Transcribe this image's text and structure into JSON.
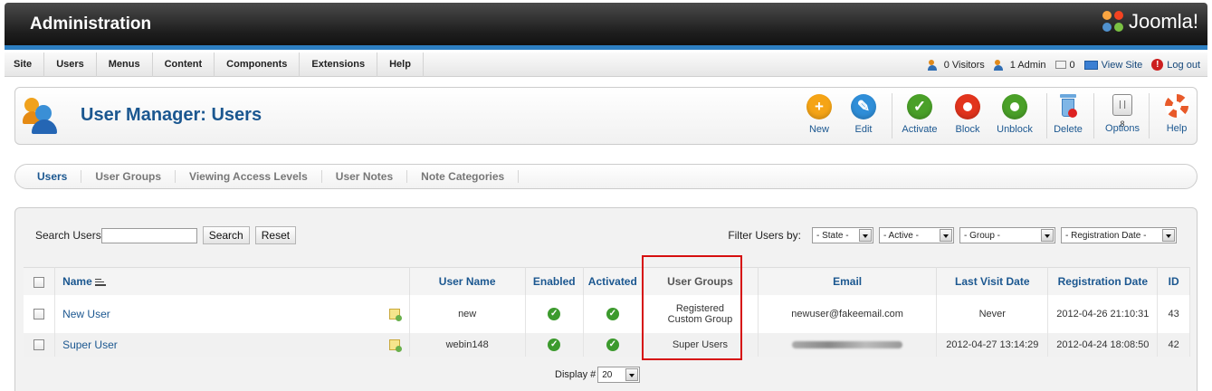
{
  "header": {
    "title": "Administration",
    "logo_text": "Joomla!"
  },
  "menu": [
    "Site",
    "Users",
    "Menus",
    "Content",
    "Components",
    "Extensions",
    "Help"
  ],
  "status": {
    "visitors": "0 Visitors",
    "admins": "1 Admin",
    "messages": "0",
    "view_site": "View Site",
    "logout": "Log out"
  },
  "page": {
    "title": "User Manager: Users"
  },
  "toolbar": {
    "new": "New",
    "edit": "Edit",
    "activate": "Activate",
    "block": "Block",
    "unblock": "Unblock",
    "delete": "Delete",
    "options": "Options",
    "help": "Help",
    "options_glyph": "|| 8"
  },
  "subnav": [
    "Users",
    "User Groups",
    "Viewing Access Levels",
    "User Notes",
    "Note Categories"
  ],
  "search": {
    "label": "Search Users",
    "value": "",
    "search_button": "Search",
    "reset_button": "Reset"
  },
  "filters": {
    "label": "Filter Users by:",
    "state": "- State -",
    "active": "- Active -",
    "group": "- Group -",
    "registration_date": "- Registration Date -"
  },
  "table": {
    "headers": {
      "name": "Name",
      "username": "User Name",
      "enabled": "Enabled",
      "activated": "Activated",
      "groups": "User Groups",
      "email": "Email",
      "last_visit": "Last Visit Date",
      "registration": "Registration Date",
      "id": "ID"
    },
    "rows": [
      {
        "name": "New User",
        "username": "new",
        "groups_1": "Registered",
        "groups_2": "Custom Group",
        "email": "newuser@fakeemail.com",
        "last_visit": "Never",
        "registration": "2012-04-26 21:10:31",
        "id": "43"
      },
      {
        "name": "Super User",
        "username": "webin148",
        "groups_1": "Super Users",
        "groups_2": "",
        "email": "",
        "last_visit": "2012-04-27 13:14:29",
        "registration": "2012-04-24 18:08:50",
        "id": "42"
      }
    ]
  },
  "pager": {
    "label": "Display #",
    "value": "20"
  },
  "colors": {
    "header_blue": "#2d7fc2",
    "link_blue": "#1b5790",
    "highlight_red": "#d60f0f"
  }
}
